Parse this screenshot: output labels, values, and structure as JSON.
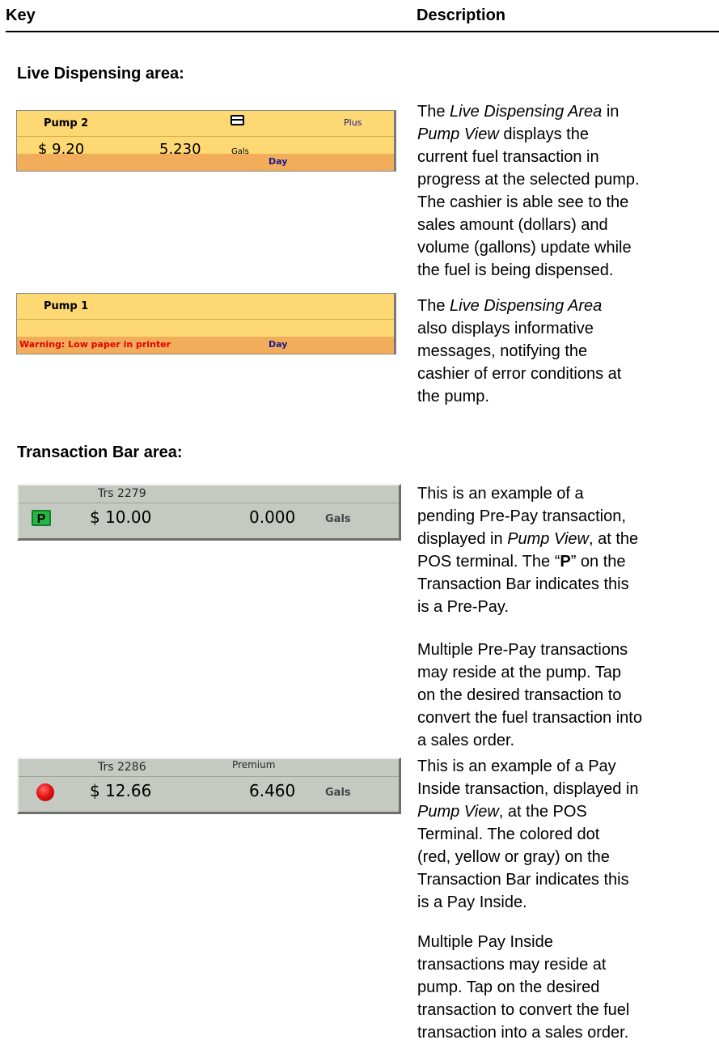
{
  "header": {
    "key_label": "Key",
    "description_label": "Description"
  },
  "live_section": {
    "title": "Live Dispensing area:",
    "panel1": {
      "pump": "Pump 2",
      "grade": "Plus",
      "amount": "$ 9.20",
      "volume": "5.230",
      "unit": "Gals",
      "shift": "Day"
    },
    "panel2": {
      "pump": "Pump 1",
      "warning": "Warning: Low paper in printer",
      "shift": "Day"
    },
    "desc1": {
      "t1": "The ",
      "em1": "Live Dispensing Area",
      "t2": " in",
      "em2": "Pump View",
      "t3": " displays the",
      "l3": "current fuel transaction in",
      "l4": "progress at the selected pump.",
      "l5": "The cashier is able see to the",
      "l6": "sales amount (dollars) and",
      "l7": "volume (gallons) update while",
      "l8": "the fuel is being dispensed."
    },
    "desc2": {
      "t1": "The ",
      "em1": "Live Dispensing Area",
      "l2": "also displays informative",
      "l3": "messages, notifying the",
      "l4": "cashier of error conditions at",
      "l5": "the pump."
    }
  },
  "transaction_section": {
    "title": "Transaction Bar area:",
    "bar1": {
      "trs": "Trs 2279",
      "amount": "$ 10.00",
      "volume": "0.000",
      "unit": "Gals",
      "icon_letter": "P"
    },
    "bar2": {
      "trs": "Trs 2286",
      "grade": "Premium",
      "amount": "$ 12.66",
      "volume": "6.460",
      "unit": "Gals"
    },
    "desc1": {
      "l1": "This is an example of a",
      "l2": "pending Pre-Pay transaction,",
      "t3a": "displayed in ",
      "em3": "Pump View",
      "t3b": ", at the",
      "t4a": "POS terminal.  The “",
      "b4": "P",
      "t4b": "” on the",
      "l5": "Transaction Bar indicates this",
      "l6": "is a Pre-Pay."
    },
    "desc2": {
      "l1": "Multiple Pre-Pay transactions",
      "l2": "may reside at the pump.  Tap",
      "l3": "on the desired transaction to",
      "l4": "convert the fuel transaction into",
      "l5": "a sales order."
    },
    "desc3": {
      "l1": "This is an example of a Pay",
      "l2": "Inside transaction, displayed in",
      "em3": "Pump View",
      "t3": ", at the POS",
      "l4": "Terminal.  The colored dot",
      "l5": "(red, yellow or gray) on the",
      "l6": "Transaction Bar indicates this",
      "l7": "is a Pay Inside."
    },
    "desc4": {
      "l1": "Multiple Pay Inside",
      "l2": "transactions may reside at",
      "l3": "pump.  Tap on the desired",
      "l4": "transaction to convert the fuel",
      "l5": "transaction into a sales order."
    }
  },
  "colors": {
    "panel_yellow": "#fdd873",
    "panel_orange": "#f1ad5a",
    "warning_red": "#e40000",
    "bar_gray": "#c4c9c1",
    "dot_red": "#e41414",
    "p_green": "#1fa63a"
  }
}
